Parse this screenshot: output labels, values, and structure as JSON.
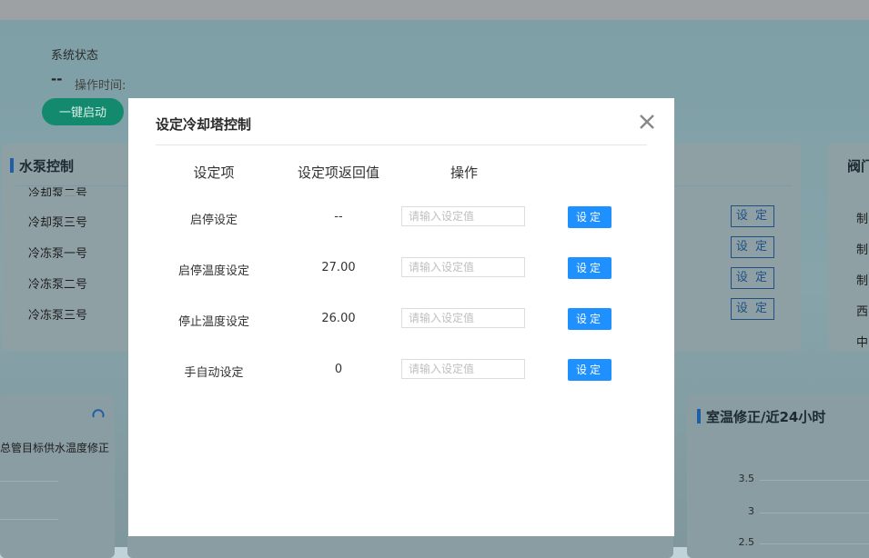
{
  "background": {
    "system_status": {
      "title": "系统状态",
      "value": "--",
      "op_time_label": "操作时间:",
      "one_key_start": "一键启动"
    },
    "pump_panel": {
      "title": "水泵控制",
      "pumps": [
        "冷却泵二号",
        "冷却泵三号",
        "冷冻泵一号",
        "冷冻泵二号",
        "冷冻泵三号"
      ],
      "set_label": "设 定"
    },
    "valve_panel": {
      "title": "阀门",
      "rows": [
        "制",
        "制",
        "制",
        "西",
        "中"
      ]
    },
    "left_chart": {
      "label": "总管目标供水温度修正"
    },
    "room_temp_chart": {
      "title": "室温修正/近24小时",
      "y_ticks": [
        "3.5",
        "3",
        "2.5"
      ]
    }
  },
  "modal": {
    "title": "设定冷却塔控制",
    "close_icon": "close-icon",
    "columns": [
      "设定项",
      "设定项返回值",
      "操作"
    ],
    "input_placeholder": "请输入设定值",
    "set_button_label": "设定",
    "rows": [
      {
        "name": "启停设定",
        "value": "--"
      },
      {
        "name": "启停温度设定",
        "value": "27.00"
      },
      {
        "name": "停止温度设定",
        "value": "26.00"
      },
      {
        "name": "手自动设定",
        "value": "0"
      }
    ]
  },
  "colors": {
    "accent": "#1e90ff",
    "start_button": "#138a6e",
    "title_marker": "#1f5fa8"
  }
}
